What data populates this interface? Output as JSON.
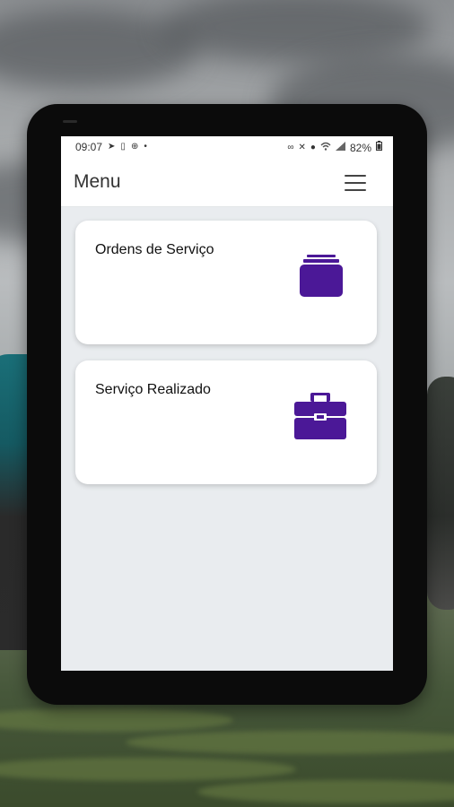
{
  "status_bar": {
    "time": "09:07",
    "left_icons": [
      "send-icon",
      "phone-icon",
      "search-icon",
      "dot-icon"
    ],
    "right_icons": [
      "voicemail-icon",
      "mute-icon",
      "location-icon",
      "wifi-icon",
      "signal-icon"
    ],
    "battery": "82%"
  },
  "app_bar": {
    "title": "Menu",
    "menu_icon": "hamburger-menu-icon"
  },
  "cards": [
    {
      "label": "Ordens de Serviço",
      "icon": "stacked-folder-icon"
    },
    {
      "label": "Serviço Realizado",
      "icon": "toolbox-icon"
    }
  ],
  "colors": {
    "accent": "#4b1897",
    "screen_bg": "#e9ecef",
    "card_bg": "#ffffff"
  }
}
